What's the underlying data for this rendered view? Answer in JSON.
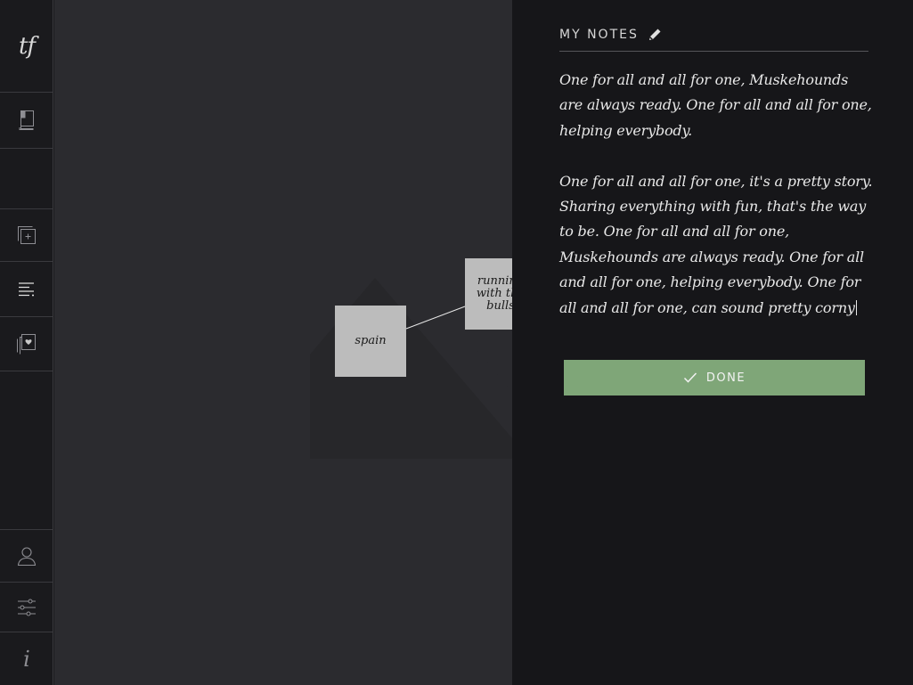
{
  "sidebar": {
    "logo": "tf",
    "info_glyph": "i",
    "icons": {
      "book": "book-icon",
      "add": "add-card-icon",
      "notes": "notes-lines-icon",
      "favorites": "favorite-cards-icon",
      "user": "user-icon",
      "settings": "sliders-icon",
      "info": "info-icon"
    }
  },
  "canvas": {
    "nodes": {
      "spain": "spain",
      "running": "running with the bulls"
    }
  },
  "notes": {
    "title": "MY NOTES",
    "paragraph_1": "One for all and all for one, Muskehounds are always ready. One for all and all for one, helping everybody.",
    "paragraph_2": "One for all and all for one, it's a pretty story. Sharing everything with fun, that's the way to be. One for all and all for one, Muskehounds are always ready. One for all and all for one, helping everybody. One for all and all for one, can sound pretty corny",
    "done_label": "DONE"
  },
  "colors": {
    "done_button": "#7fa678",
    "panel_bg": "#161619",
    "canvas_bg": "#2b2b2f",
    "node_bg": "#bcbcbc"
  }
}
